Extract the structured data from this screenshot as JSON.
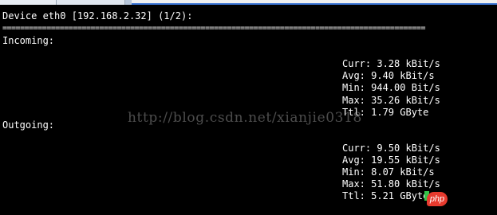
{
  "header": {
    "device_line": "Device eth0 [192.168.2.32] (1/2):",
    "separator": "================================================================================================"
  },
  "incoming": {
    "label": "Incoming:",
    "curr": "Curr: 3.28 kBit/s",
    "avg": "Avg: 9.40 kBit/s",
    "min": "Min: 944.00 Bit/s",
    "max": "Max: 35.26 kBit/s",
    "ttl": "Ttl: 1.79 GByte"
  },
  "outgoing": {
    "label": "Outgoing:",
    "curr": "Curr: 9.50 kBit/s",
    "avg": "Avg: 19.55 kBit/s",
    "min": "Min: 8.07 kBit/s",
    "max": "Max: 51.80 kBit/s",
    "ttl": "Ttl: 5.21 GByte"
  },
  "watermark": "http://blog.csdn.net/xianjie0318",
  "badge": "php",
  "colors": {
    "background": "#000000",
    "text": "#ffffff",
    "cursor": "#34c34a",
    "badge": "#e63a2e"
  }
}
